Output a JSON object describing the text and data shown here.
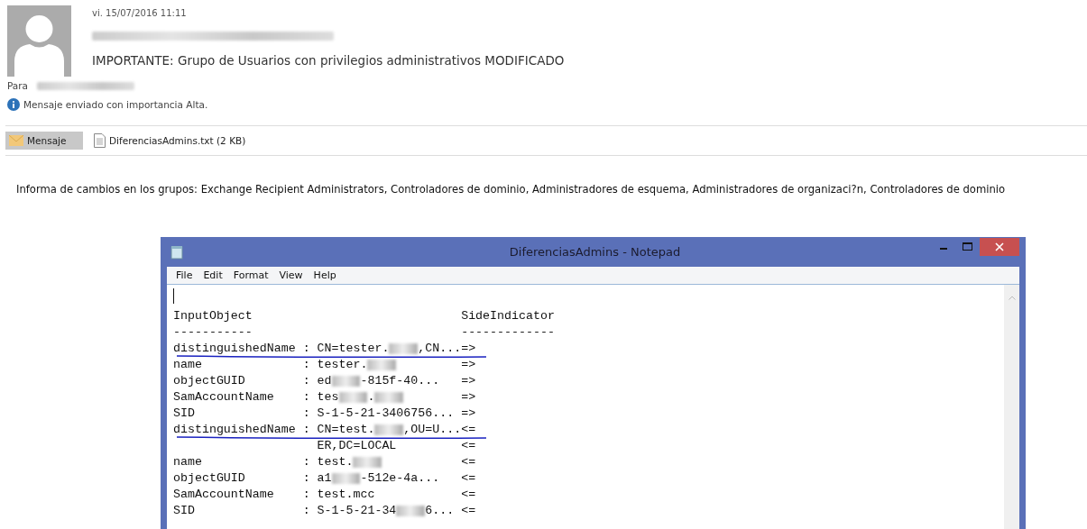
{
  "email": {
    "date": "vi. 15/07/2016 11:11",
    "sender_redacted": true,
    "subject": "IMPORTANTE: Grupo de Usuarios con privilegios administrativos MODIFICADO",
    "to_label": "Para",
    "to_redacted": true,
    "notice": "Mensaje enviado con importancia Alta."
  },
  "attachments": [
    {
      "kind": "message",
      "label": "Mensaje",
      "selected": true
    },
    {
      "kind": "file",
      "label": "DiferenciasAdmins.txt (2 KB)",
      "selected": false
    }
  ],
  "body": "Informa de cambios en los grupos: Exchange Recipient Administrators, Controladores de dominio, Administradores de esquema, Administradores de organizaci?n, Controladores de dominio",
  "notepad": {
    "title": "DiferenciasAdmins - Notepad",
    "menu": [
      "File",
      "Edit",
      "Format",
      "View",
      "Help"
    ],
    "lines": [
      {
        "key": "InputObject",
        "indicator": "SideIndicator",
        "underlined": false
      },
      {
        "key": "-----------",
        "indicator": "-------------",
        "underlined": false
      },
      {
        "key": "distinguishedName",
        "sep": ":",
        "parts": [
          {
            "kind": "text",
            "text": "CN=tester."
          },
          {
            "kind": "blur"
          },
          {
            "kind": "text",
            "text": ",CN..."
          }
        ],
        "indicator": "=>",
        "underlined": true
      },
      {
        "key": "name",
        "sep": ":",
        "parts": [
          {
            "kind": "text",
            "text": "tester."
          },
          {
            "kind": "blur"
          }
        ],
        "indicator": "=>",
        "underlined": false
      },
      {
        "key": "objectGUID",
        "sep": ":",
        "parts": [
          {
            "kind": "text",
            "text": "ed"
          },
          {
            "kind": "blur"
          },
          {
            "kind": "text",
            "text": "-815f-40..."
          }
        ],
        "indicator": "=>",
        "underlined": false
      },
      {
        "key": "SamAccountName",
        "sep": ":",
        "parts": [
          {
            "kind": "text",
            "text": "tes"
          },
          {
            "kind": "blur"
          },
          {
            "kind": "text",
            "text": "."
          },
          {
            "kind": "blur"
          }
        ],
        "indicator": "=>",
        "underlined": false
      },
      {
        "key": "SID",
        "sep": ":",
        "parts": [
          {
            "kind": "text",
            "text": "S-1-5-21-3406756..."
          }
        ],
        "indicator": "=>",
        "underlined": false
      },
      {
        "key": "distinguishedName",
        "sep": ":",
        "parts": [
          {
            "kind": "text",
            "text": "CN=test."
          },
          {
            "kind": "blur"
          },
          {
            "kind": "text",
            "text": ",OU=U..."
          }
        ],
        "indicator": "<=",
        "underlined": true
      },
      {
        "parts": [
          {
            "kind": "text",
            "text": "ER,DC=LOCAL"
          }
        ],
        "indicator": "<=",
        "underlined": false
      },
      {
        "key": "name",
        "sep": ":",
        "parts": [
          {
            "kind": "text",
            "text": "test."
          },
          {
            "kind": "blur"
          }
        ],
        "indicator": "<=",
        "underlined": false
      },
      {
        "key": "objectGUID",
        "sep": ":",
        "parts": [
          {
            "kind": "text",
            "text": "a1"
          },
          {
            "kind": "blur"
          },
          {
            "kind": "text",
            "text": "-512e-4a..."
          }
        ],
        "indicator": "<=",
        "underlined": false
      },
      {
        "key": "SamAccountName",
        "sep": ":",
        "parts": [
          {
            "kind": "text",
            "text": "test.mcc"
          }
        ],
        "indicator": "<=",
        "underlined": false
      },
      {
        "key": "SID",
        "sep": ":",
        "parts": [
          {
            "kind": "text",
            "text": "S-1-5-21-34"
          },
          {
            "kind": "blur"
          },
          {
            "kind": "text",
            "text": "6..."
          }
        ],
        "indicator": "<=",
        "underlined": false
      }
    ]
  }
}
